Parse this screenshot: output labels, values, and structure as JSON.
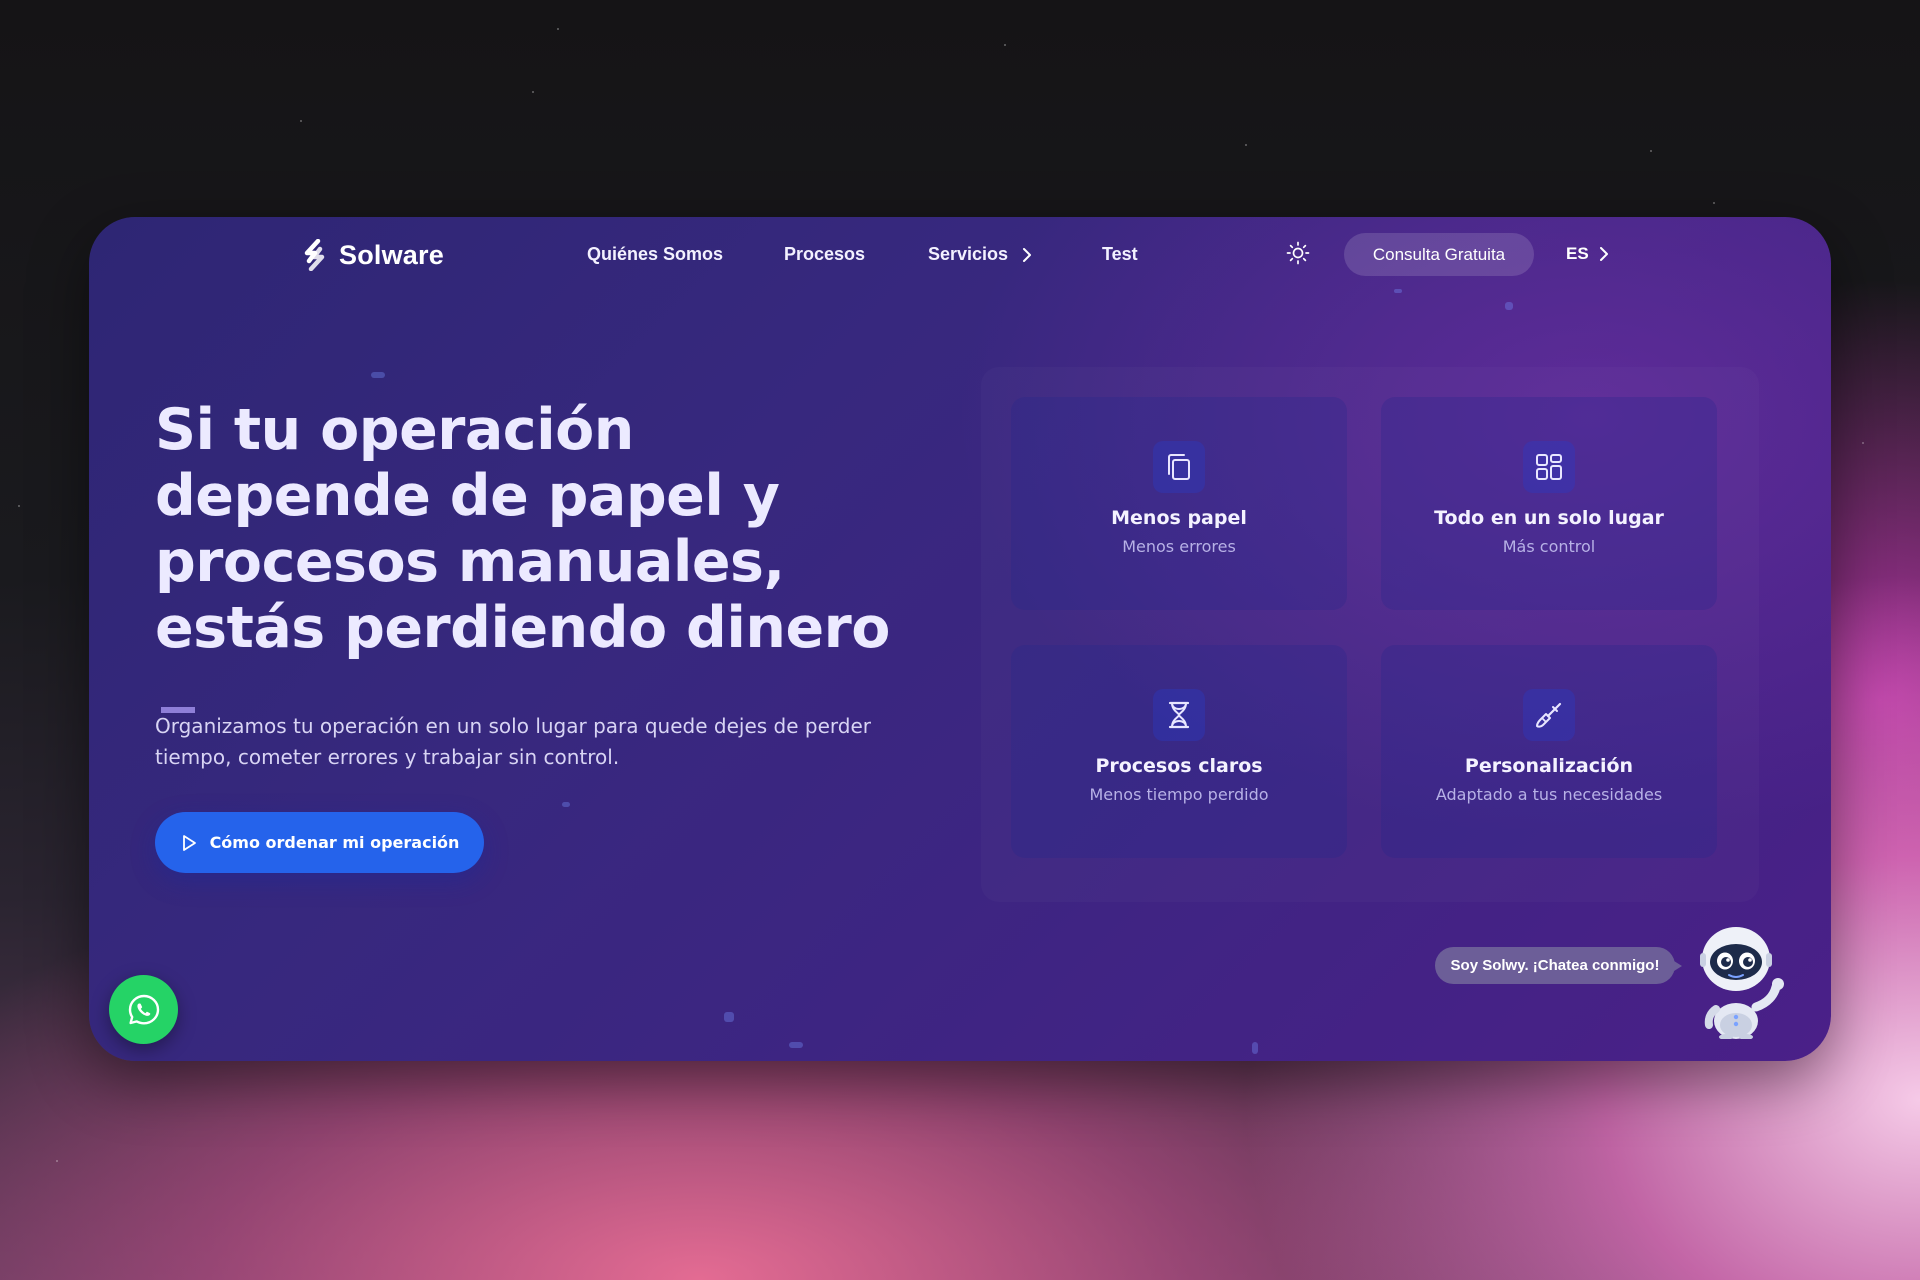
{
  "nav": {
    "brand": "Solware",
    "links": [
      {
        "label": "Quiénes Somos"
      },
      {
        "label": "Procesos"
      },
      {
        "label": "Servicios"
      },
      {
        "label": "Test"
      }
    ],
    "cta_label": "Consulta Gratuita",
    "language": "ES"
  },
  "hero": {
    "title": "Si tu operación depende de papel y procesos manuales, estás perdiendo dinero",
    "subtitle": "Organizamos tu operación en un solo lugar para quede dejes de perder tiempo, cometer errores y trabajar sin control.",
    "button_label": "Cómo ordenar mi operación"
  },
  "features": [
    {
      "title": "Menos papel",
      "subtitle": "Menos errores",
      "icon": "copy-icon"
    },
    {
      "title": "Todo en un solo lugar",
      "subtitle": "Más control",
      "icon": "dashboard-icon"
    },
    {
      "title": "Procesos claros",
      "subtitle": "Menos tiempo perdido",
      "icon": "hourglass-icon"
    },
    {
      "title": "Personalización",
      "subtitle": "Adaptado a tus necesidades",
      "icon": "paintbrush-icon"
    }
  ],
  "chat": {
    "bubble_text": "Soy Solwy. ¡Chatea conmigo!"
  },
  "colors": {
    "primary_button": "#2563eb",
    "whatsapp": "#25d366",
    "panel": "#37287e"
  }
}
